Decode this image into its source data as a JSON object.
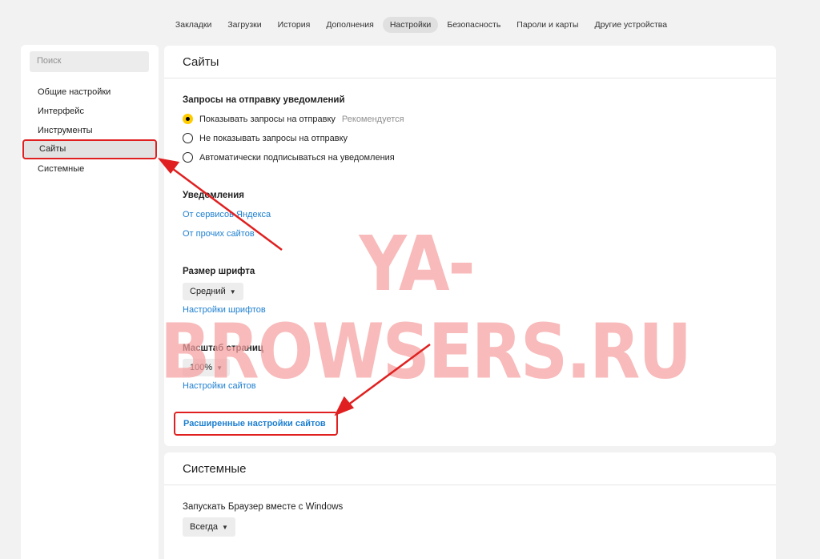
{
  "topnav": {
    "tabs": [
      {
        "label": "Закладки"
      },
      {
        "label": "Загрузки"
      },
      {
        "label": "История"
      },
      {
        "label": "Дополнения"
      },
      {
        "label": "Настройки",
        "active": true
      },
      {
        "label": "Безопасность"
      },
      {
        "label": "Пароли и карты"
      },
      {
        "label": "Другие устройства"
      }
    ]
  },
  "sidebar": {
    "search_placeholder": "Поиск",
    "items": [
      {
        "label": "Общие настройки"
      },
      {
        "label": "Интерфейс"
      },
      {
        "label": "Инструменты"
      },
      {
        "label": "Сайты",
        "active": true
      },
      {
        "label": "Системные"
      }
    ]
  },
  "sites": {
    "title": "Сайты",
    "notif_requests": {
      "heading": "Запросы на отправку уведомлений",
      "options": [
        {
          "label": "Показывать запросы на отправку",
          "hint": "Рекомендуется",
          "checked": true
        },
        {
          "label": "Не показывать запросы на отправку",
          "checked": false
        },
        {
          "label": "Автоматически подписываться на уведомления",
          "checked": false
        }
      ]
    },
    "notifications": {
      "heading": "Уведомления",
      "link_yandex": "От сервисов Яндекса",
      "link_other": "От прочих сайтов"
    },
    "font_size": {
      "heading": "Размер шрифта",
      "value": "Средний",
      "link": "Настройки шрифтов"
    },
    "page_zoom": {
      "heading": "Масштаб страниц",
      "value": "100%",
      "link": "Настройки сайтов"
    },
    "advanced_link": "Расширенные настройки сайтов"
  },
  "system": {
    "title": "Системные",
    "startup": {
      "heading": "Запускать Браузер вместе с Windows",
      "value": "Всегда"
    }
  },
  "watermark": "YA-BROWSERS.RU",
  "colors": {
    "accent_link": "#1d7fd0",
    "highlight_border": "#e02020",
    "radio_checked": "#ffcc00",
    "watermark": "#f5a0a0"
  }
}
